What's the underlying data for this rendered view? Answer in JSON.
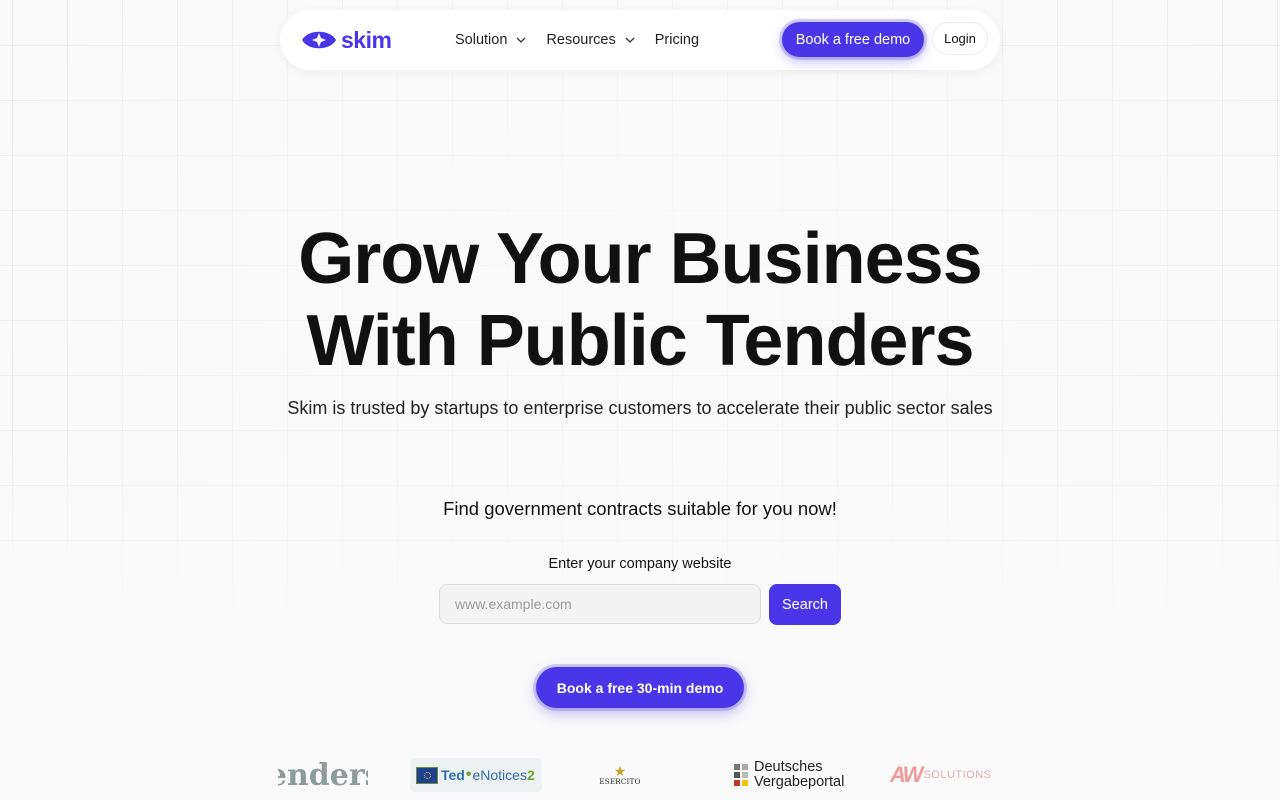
{
  "brand": {
    "name": "skim",
    "color": "#4a35e8"
  },
  "nav": {
    "items": [
      {
        "label": "Solution",
        "has_dropdown": true
      },
      {
        "label": "Resources",
        "has_dropdown": true
      },
      {
        "label": "Pricing",
        "has_dropdown": false
      }
    ],
    "demo_button": "Book a free demo",
    "login_button": "Login"
  },
  "hero": {
    "title_line1": "Grow Your Business",
    "title_line2": "With Public Tenders",
    "subtitle": "Skim is trusted by startups to enterprise customers to accelerate their public sector sales"
  },
  "search": {
    "prompt": "Find government contracts suitable for you now!",
    "label": "Enter your company website",
    "placeholder": "www.example.com",
    "value": "",
    "button": "Search"
  },
  "cta": {
    "label": "Book a free 30-min demo"
  },
  "partner_logos": [
    {
      "name": "tenders-logo",
      "text": "tenders"
    },
    {
      "name": "ted-enotices2-logo",
      "text_a": "Ted",
      "text_sep": "•",
      "text_b": "eNotices",
      "text_c": "2"
    },
    {
      "name": "esercito-logo",
      "text": "ESERCITO"
    },
    {
      "name": "deutsches-vergabeportal-logo",
      "line1": "Deutsches",
      "line2": "Vergabeportal"
    },
    {
      "name": "aw-solutions-logo",
      "mark": "AW",
      "text": "SOLUTIONS"
    }
  ]
}
